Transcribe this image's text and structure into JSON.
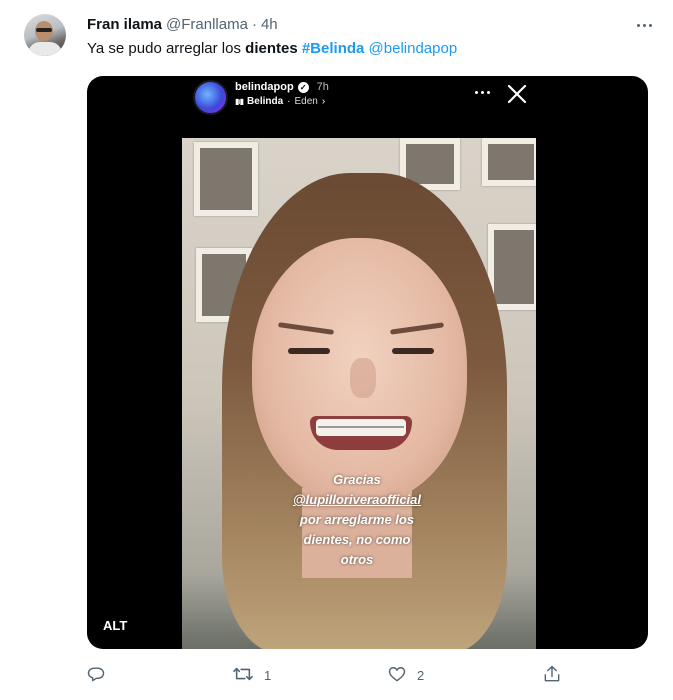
{
  "tweet": {
    "author_name": "Fran ilama",
    "author_handle": "@Franllama",
    "separator": "·",
    "timestamp": "4h",
    "text_prefix": "Ya se pudo arreglar los ",
    "text_bold": "dientes",
    "hashtag": "#Belinda",
    "mention": "@belindapop"
  },
  "media": {
    "alt_label": "ALT",
    "story": {
      "username": "belindapop",
      "time": "7h",
      "music_artist": "Belinda",
      "music_separator": "·",
      "music_song": "Eden",
      "caption_lines": [
        "Gracias",
        "@lupilloriveraofficial",
        "por arreglarme los",
        "dientes, no como",
        "otros"
      ]
    }
  },
  "actions": {
    "reply_count": "",
    "retweet_count": "1",
    "like_count": "2"
  },
  "colors": {
    "link": "#1d9bf0",
    "secondary_text": "#536471",
    "primary_text": "#0f1419"
  }
}
